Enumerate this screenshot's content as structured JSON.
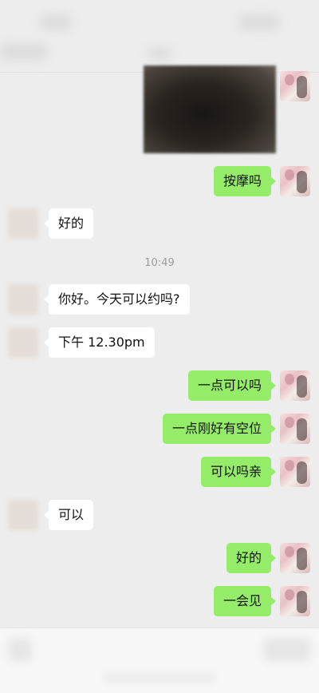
{
  "messages": [
    {
      "side": "right",
      "text": "按摩吗"
    },
    {
      "side": "left",
      "text": "好的"
    },
    {
      "side": "left",
      "text": "你好。今天可以约吗?"
    },
    {
      "side": "left",
      "text": "下午 12.30pm"
    },
    {
      "side": "right",
      "text": "一点可以吗"
    },
    {
      "side": "right",
      "text": "一点刚好有空位"
    },
    {
      "side": "right",
      "text": "可以吗亲"
    },
    {
      "side": "left",
      "text": "可以"
    },
    {
      "side": "right",
      "text": "好的"
    },
    {
      "side": "right",
      "text": "一会见"
    }
  ],
  "timestamp": "10:49",
  "colors": {
    "self_bubble": "#95ec69",
    "other_bubble": "#ffffff",
    "background": "#ededed"
  }
}
